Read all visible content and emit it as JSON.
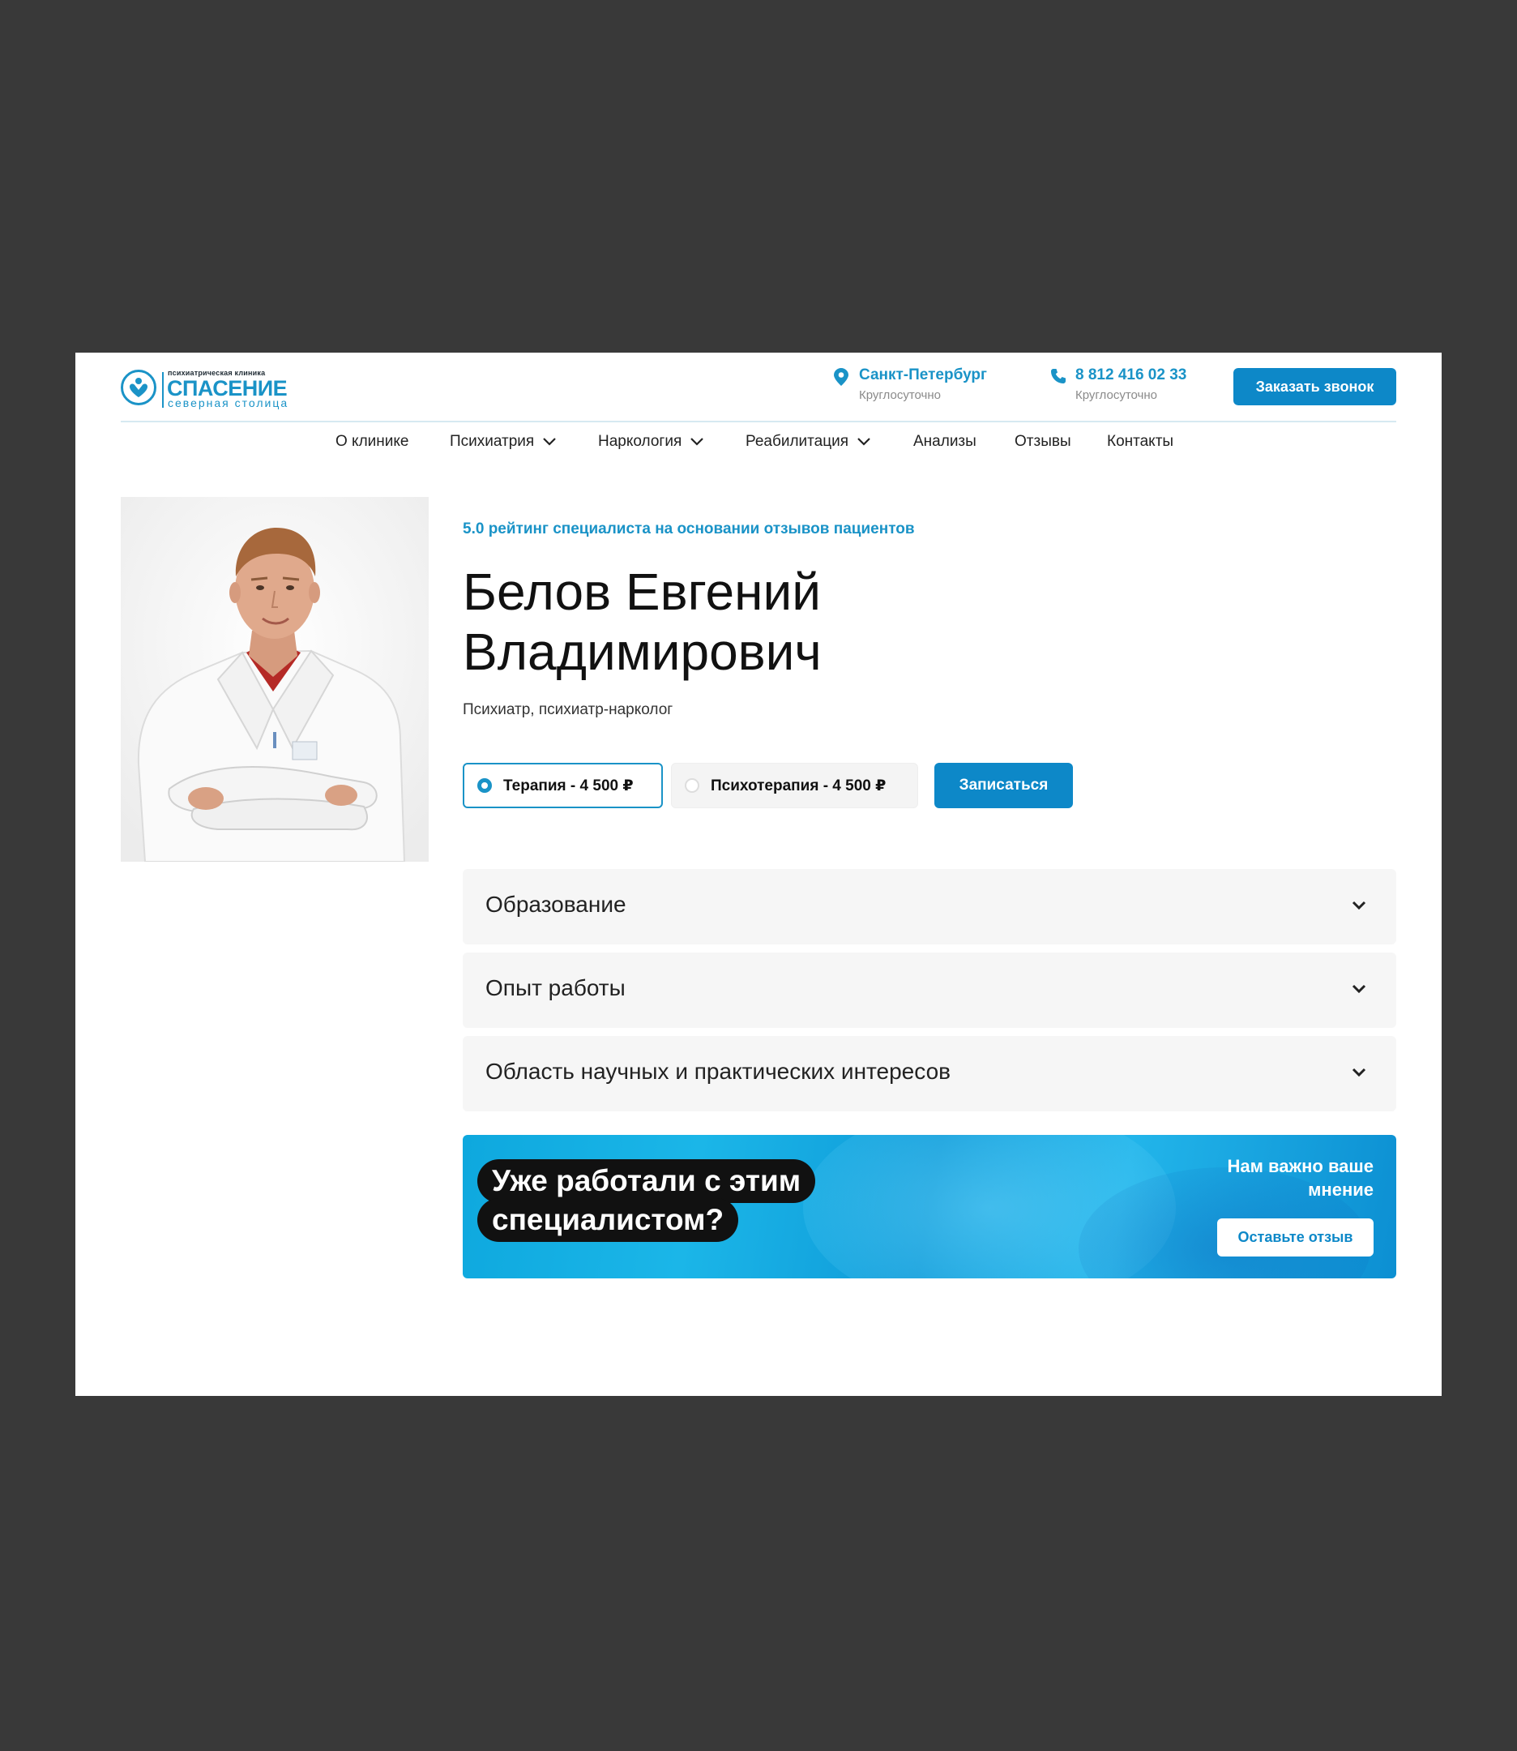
{
  "logo": {
    "top_text": "психиатрическая клиника",
    "main_text": "СПАСЕНИЕ",
    "sub_text": "северная столица"
  },
  "header": {
    "city": "Санкт-Петербург",
    "city_hours": "Круглосуточно",
    "phone": "8 812 416 02 33",
    "phone_hours": "Круглосуточно",
    "call_button": "Заказать звонок"
  },
  "nav": {
    "items": [
      {
        "label": "О клинике"
      },
      {
        "label": "Психиатрия"
      },
      {
        "label": "Наркология"
      },
      {
        "label": "Реабилитация"
      },
      {
        "label": "Анализы"
      },
      {
        "label": "Отзывы"
      },
      {
        "label": "Контакты"
      }
    ]
  },
  "doctor": {
    "rating_text": "5.0 рейтинг специалиста на основании отзывов пациентов",
    "name_line1": "Белов Евгений",
    "name_line2": "Владимирович",
    "specialty": "Психиатр, психиатр-нарколог"
  },
  "booking": {
    "options": [
      {
        "label": "Терапия - 4 500 ₽",
        "selected": true
      },
      {
        "label": "Психотерапия - 4 500 ₽",
        "selected": false
      }
    ],
    "book_button": "Записаться"
  },
  "accordion": {
    "items": [
      {
        "title": "Образование"
      },
      {
        "title": "Опыт работы"
      },
      {
        "title": "Область научных и практических интересов"
      }
    ]
  },
  "banner": {
    "line1": "Уже работали с этим",
    "line2": "специалистом?",
    "opinion": "Нам важно ваше мнение",
    "review_button": "Оставьте отзыв"
  },
  "colors": {
    "accent": "#0d88c8",
    "brand": "#1a93c7",
    "background": "#393939"
  }
}
